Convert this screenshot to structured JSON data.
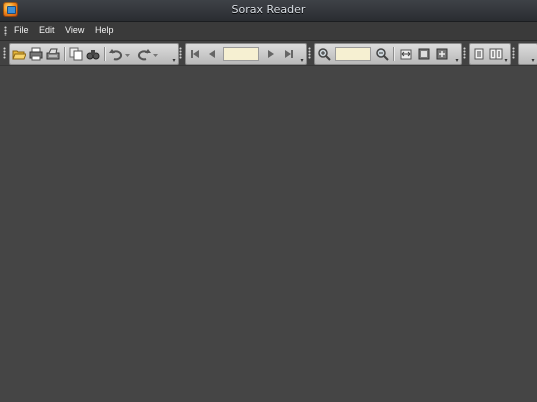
{
  "window": {
    "title": "Sorax Reader"
  },
  "menu": {
    "items": [
      "File",
      "Edit",
      "View",
      "Help"
    ]
  },
  "toolbar": {
    "page_field_value": "",
    "zoom_field_value": "",
    "icons": [
      "open-folder-icon",
      "print-icon",
      "scan-icon",
      "copy-icon",
      "find-icon",
      "undo-icon",
      "undo-dropdown-icon",
      "redo-icon",
      "redo-dropdown-icon",
      "first-page-icon",
      "previous-page-icon",
      "next-page-icon",
      "last-page-icon",
      "zoom-in-icon",
      "zoom-out-icon",
      "fit-width-icon",
      "fit-page-icon",
      "actual-size-icon",
      "single-page-icon",
      "two-page-icon"
    ]
  },
  "colors": {
    "workspace": "#454545",
    "titlebar": "#2f3236",
    "toolbar_face": "#c8c8c8",
    "field_bg": "#f6f0d2"
  }
}
